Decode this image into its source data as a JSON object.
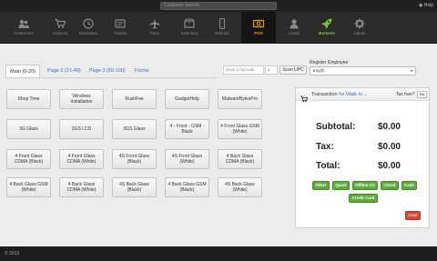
{
  "topbar": {
    "search_placeholder": "Customer Search",
    "help": "Help"
  },
  "nav": [
    {
      "label": "Customers",
      "icon": "users-icon"
    },
    {
      "label": "Invoices",
      "icon": "cart-icon"
    },
    {
      "label": "Estimates",
      "icon": "clock-icon"
    },
    {
      "label": "Tickets",
      "icon": "ticket-icon"
    },
    {
      "label": "Parts",
      "icon": "plane-icon"
    },
    {
      "label": "Inventory",
      "icon": "box-icon"
    },
    {
      "label": "Refurbs",
      "icon": "phone-icon"
    },
    {
      "label": "POS",
      "icon": "money-icon"
    },
    {
      "label": "Leads",
      "icon": "user-icon"
    },
    {
      "label": "Marketer",
      "icon": "rocket-icon"
    },
    {
      "label": "Admin",
      "icon": "gear-icon"
    }
  ],
  "tabs": [
    "Main (0-20)",
    "Page 2 (21-49)",
    "Page 3 (50-100)",
    "Forms"
  ],
  "items": [
    "Shop Time",
    "Windows Installation",
    "RushFee",
    "GadgetHelp",
    "MalwareBytesPro",
    "3G Glass",
    "3GS LCD",
    "3GS Glass",
    "4 - Front - GSM - Black",
    "4 Front Glass GSM (White)",
    "4 Front Glass CDMA (Black)",
    "4 Front Glass CDMA (White)",
    "4S Front Glass (Black)",
    "4S Front Glass (White)",
    "4 Back Glass CDMA (Black)",
    "4 Back Glass GSM (White)",
    "4 Back Glass CDMA (White)",
    "4S Back Glass (Black)",
    "4 Back Glass GSM (Black)",
    "4S Back Glass (White)"
  ],
  "scan": {
    "placeholder": "Scan a barcode",
    "qty": "1",
    "button": "Scan UPC"
  },
  "register": {
    "label": "Register Employee",
    "value": "troy@"
  },
  "transaction": {
    "title": "Transaction",
    "link": "for Walk In ...",
    "tax_free_label": "Tax free?",
    "tax_free_value": "No",
    "subtotal_label": "Subtotal:",
    "subtotal": "$0.00",
    "tax_label": "Tax:",
    "tax": "$0.00",
    "total_label": "Total:",
    "total": "$0.00",
    "payments": [
      "Other",
      "Quick",
      "Offline CC",
      "Check",
      "Cash",
      "Credit Card"
    ],
    "clear": "Clear"
  },
  "footer": {
    "copyright": "© 2013"
  },
  "colors": {
    "accent": "#f4a100",
    "market": "#7ac231",
    "pay": "#5cad38",
    "clear": "#d9452f",
    "link": "#3b6fc2"
  }
}
